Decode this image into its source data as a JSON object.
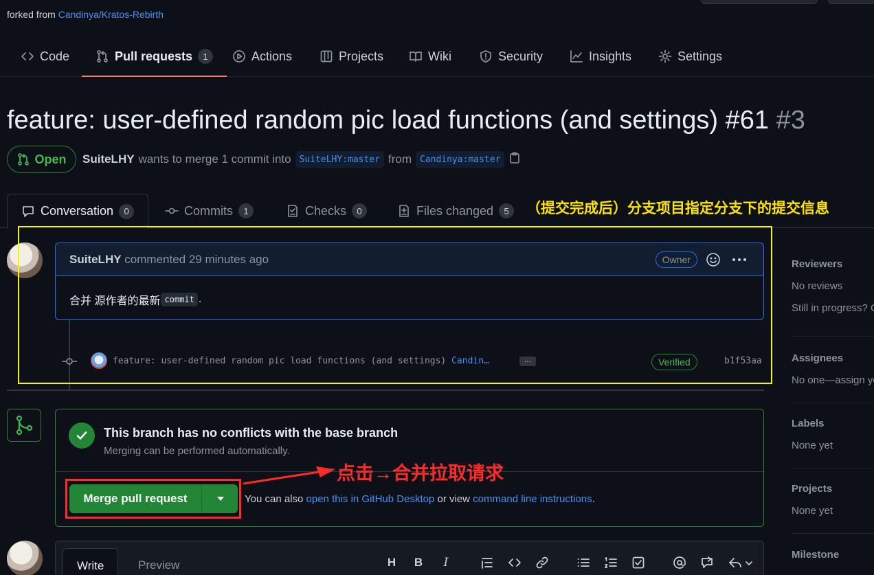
{
  "repo": {
    "forked_from_prefix": "forked from",
    "forked_from_link": "Candinya/Kratos-Rebirth"
  },
  "repo_tabs": [
    {
      "label": "Code",
      "icon": "code-icon"
    },
    {
      "label": "Pull requests",
      "icon": "pull-request-icon",
      "count": "1"
    },
    {
      "label": "Actions",
      "icon": "play-icon"
    },
    {
      "label": "Projects",
      "icon": "table-icon"
    },
    {
      "label": "Wiki",
      "icon": "book-icon"
    },
    {
      "label": "Security",
      "icon": "shield-icon"
    },
    {
      "label": "Insights",
      "icon": "graph-icon"
    },
    {
      "label": "Settings",
      "icon": "gear-icon"
    }
  ],
  "pr": {
    "title": "feature: user-defined random pic load functions (and settings) #61",
    "number": "#3",
    "state": "Open",
    "author": "SuiteLHY",
    "merge_text": "wants to merge 1 commit into",
    "base_branch": "SuiteLHY:master",
    "from_text": "from",
    "head_branch": "Candinya:master"
  },
  "pr_tabs": [
    {
      "label": "Conversation",
      "count": "0",
      "icon": "comment-icon"
    },
    {
      "label": "Commits",
      "count": "1",
      "icon": "commit-icon"
    },
    {
      "label": "Checks",
      "count": "0",
      "icon": "checklist-icon"
    },
    {
      "label": "Files changed",
      "count": "5",
      "icon": "diff-icon"
    }
  ],
  "annotations": {
    "commit_info": "（提交完成后）分支项目指定分支下的提交信息",
    "click_merge": "点击→合并拉取请求"
  },
  "comment": {
    "author": "SuiteLHY",
    "action": "commented 29 minutes ago",
    "badge": "Owner",
    "body_text": "合并 源作者的最新",
    "body_code": "commit",
    "body_end": "."
  },
  "commit": {
    "message": "feature: user-defined random pic load functions (and settings)",
    "author_short": "Candin…",
    "ellipsis": "…",
    "verified": "Verified",
    "sha": "b1f53aa"
  },
  "merge": {
    "title": "This branch has no conflicts with the base branch",
    "subtitle": "Merging can be performed automatically.",
    "button": "Merge pull request",
    "alt_prefix": "You can also",
    "alt_link1": "open this in GitHub Desktop",
    "alt_mid": "or view",
    "alt_link2": "command line instructions",
    "alt_end": "."
  },
  "sidebar": {
    "reviewers_label": "Reviewers",
    "reviewers_value": "No reviews",
    "reviewers_note": "Still in progress? C",
    "assignees_label": "Assignees",
    "assignees_value": "No one—assign yo",
    "labels_label": "Labels",
    "labels_value": "None yet",
    "projects_label": "Projects",
    "projects_value": "None yet",
    "milestone_label": "Milestone"
  },
  "editor": {
    "write_tab": "Write",
    "preview_tab": "Preview"
  },
  "colors": {
    "background": "#0d1117",
    "accent_blue": "#4493f8",
    "success_green": "#238636",
    "annotation_yellow": "#ffe400",
    "annotation_red": "#ff2a2a",
    "active_tab_underline": "#f78166"
  }
}
